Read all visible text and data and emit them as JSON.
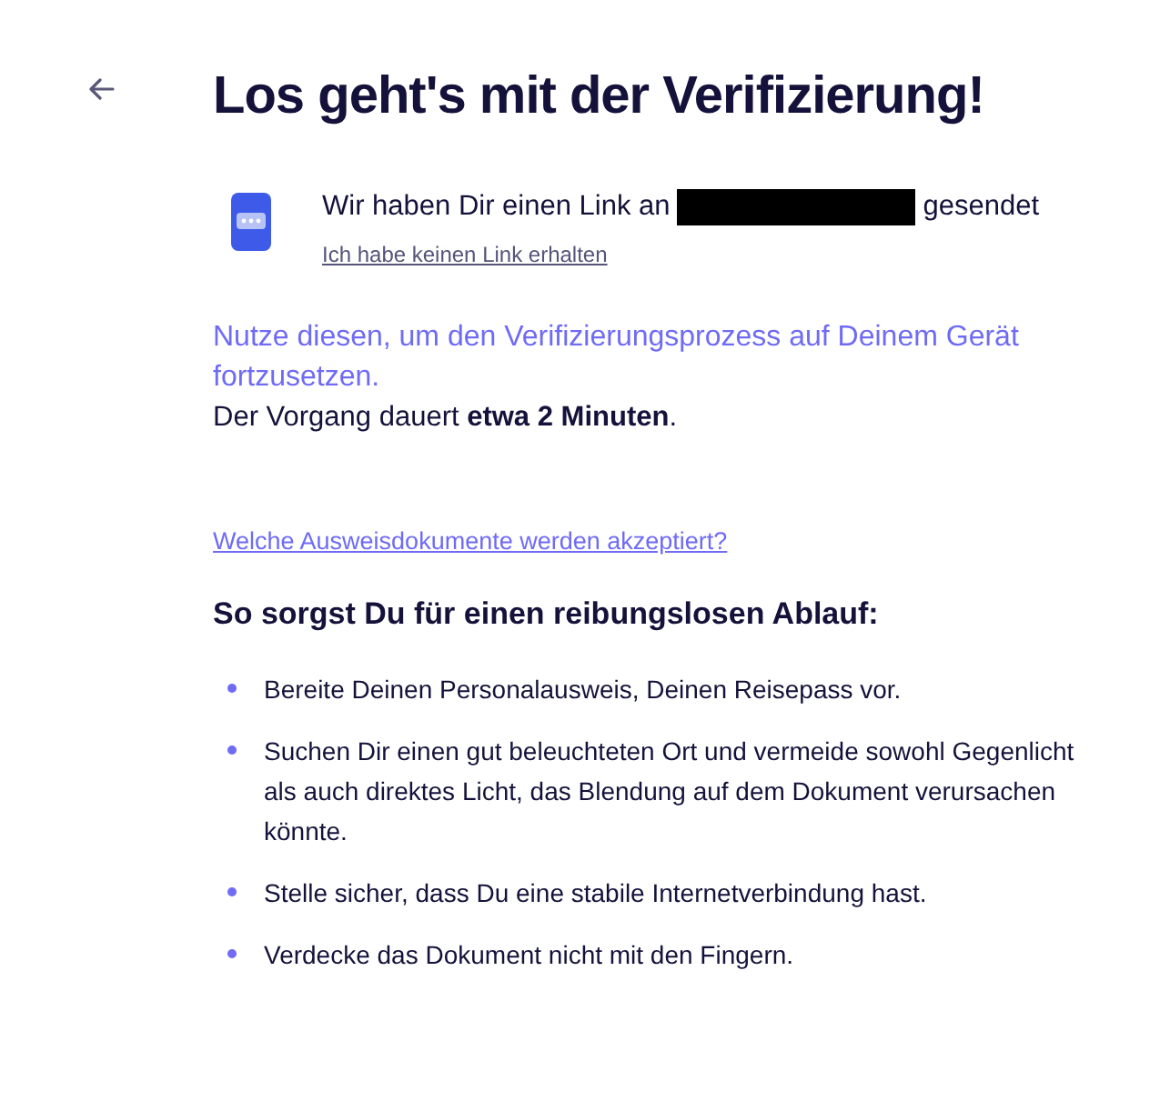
{
  "title": "Los geht's mit der Verifizierung!",
  "sent": {
    "before": "Wir haben Dir einen Link an",
    "after": "gesendet",
    "resend_link": "Ich habe keinen Link erhalten"
  },
  "info": {
    "highlight": "Nutze diesen, um den Verifizierungsprozess auf Deinem Gerät fortzusetzen.",
    "duration": "Der Vorgang dauert **etwa 2 Minuten**."
  },
  "documents_link": "Welche Ausweisdokumente werden akzeptiert?",
  "tips": {
    "heading": "So sorgst Du für einen reibungslosen Ablauf:",
    "items": [
      "Bereite Deinen Personalausweis, Deinen Reisepass vor.",
      "Suchen Dir einen gut beleuchteten Ort und vermeide sowohl Gegenlicht als auch direktes Licht, das Blendung auf dem Dokument verursachen könnte.",
      "Stelle sicher, dass Du eine stabile Internetverbindung hast.",
      "Verdecke das Dokument nicht mit den Fingern."
    ]
  }
}
